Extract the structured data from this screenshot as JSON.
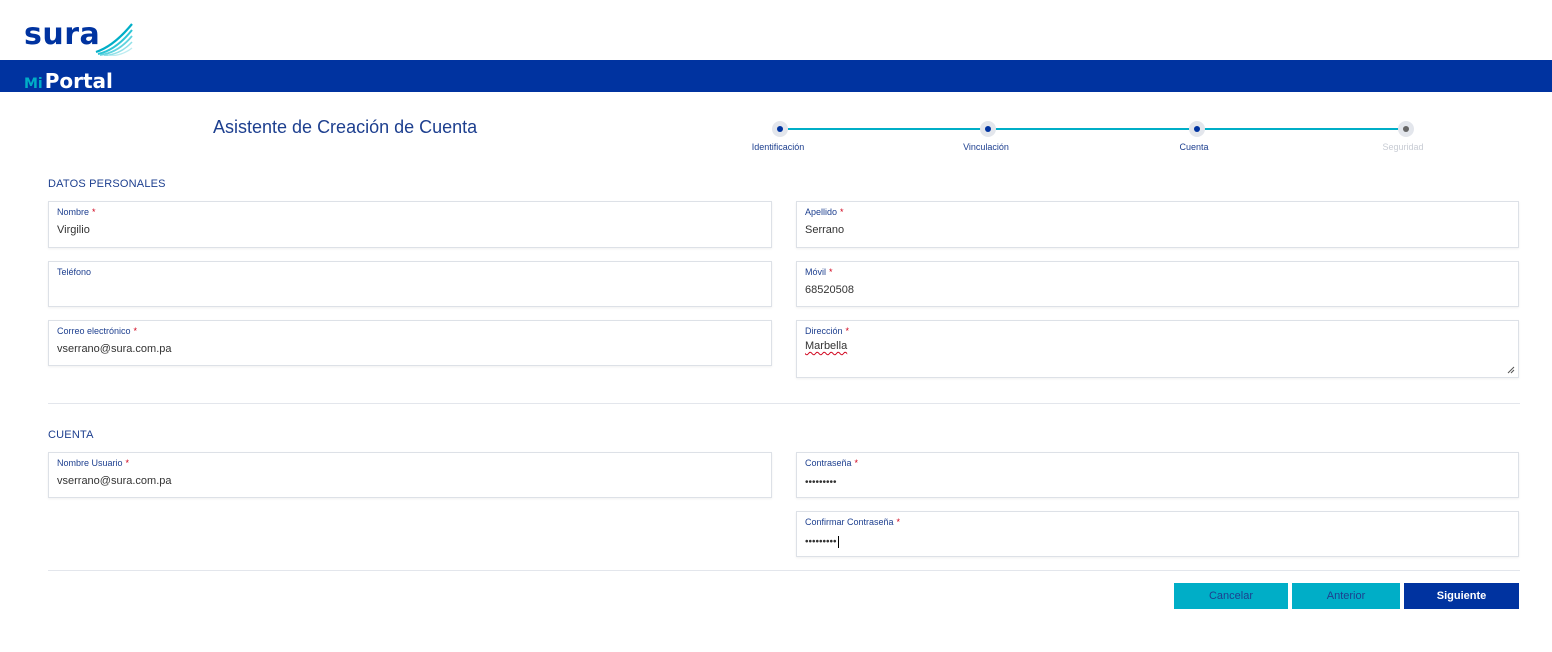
{
  "brand": {
    "logo_text": "sura",
    "portal_mi": "Mi",
    "portal_name": "Portal"
  },
  "wizard": {
    "title": "Asistente de Creación de Cuenta",
    "steps": [
      {
        "label": "Identificación",
        "state": "completed"
      },
      {
        "label": "Vinculación",
        "state": "completed"
      },
      {
        "label": "Cuenta",
        "state": "current"
      },
      {
        "label": "Seguridad",
        "state": "pending"
      }
    ]
  },
  "personal": {
    "heading": "DATOS PERSONALES",
    "nombre": {
      "label": "Nombre",
      "value": "Virgilio",
      "required": true
    },
    "apellido": {
      "label": "Apellido",
      "value": "Serrano",
      "required": true
    },
    "telefono": {
      "label": "Teléfono",
      "value": "",
      "required": false
    },
    "movil": {
      "label": "Móvil",
      "value": "68520508",
      "required": true
    },
    "correo": {
      "label": "Correo electrónico",
      "value": "vserrano@sura.com.pa",
      "required": true
    },
    "direccion": {
      "label": "Dirección",
      "value": "Marbella",
      "required": true
    }
  },
  "account": {
    "heading": "CUENTA",
    "usuario": {
      "label": "Nombre Usuario",
      "value": "vserrano@sura.com.pa",
      "required": true
    },
    "contrasena": {
      "label": "Contraseña",
      "value": "•••••••••",
      "required": true
    },
    "confirmar": {
      "label": "Confirmar Contraseña",
      "value": "•••••••••",
      "required": true
    }
  },
  "actions": {
    "cancel": "Cancelar",
    "previous": "Anterior",
    "next": "Siguiente"
  },
  "colors": {
    "primary": "#0033a0",
    "accent": "#00aec7",
    "required": "#d0021b"
  }
}
